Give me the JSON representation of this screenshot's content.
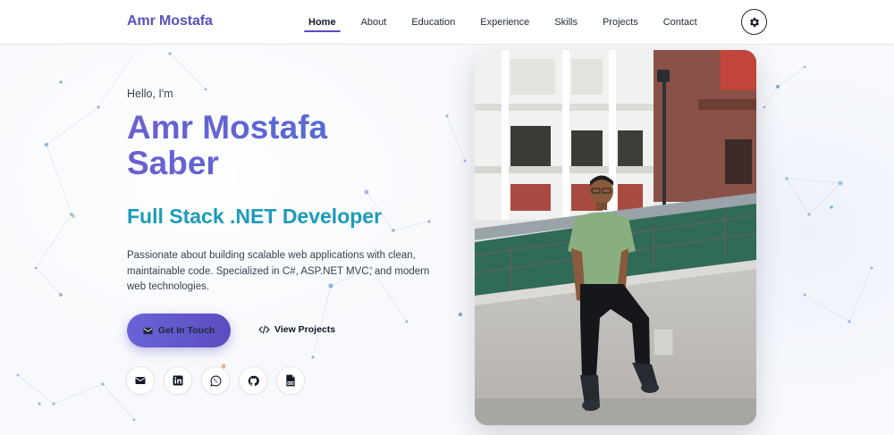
{
  "navbar": {
    "brand": "Amr Mostafa",
    "links": [
      {
        "label": "Home",
        "active": true
      },
      {
        "label": "About"
      },
      {
        "label": "Education"
      },
      {
        "label": "Experience"
      },
      {
        "label": "Skills"
      },
      {
        "label": "Projects"
      },
      {
        "label": "Contact"
      }
    ],
    "theme_toggle_icon": "gear-icon"
  },
  "hero": {
    "greeting": "Hello, I'm",
    "name": "Amr Mostafa Saber",
    "role": "Full Stack .NET Developer",
    "description": "Passionate about building scalable web applications with clean, maintainable code. Specialized in C#, ASP.NET MVC, and modern web technologies.",
    "primary_button": {
      "label": "Get In Touch",
      "icon": "envelope-icon"
    },
    "secondary_button": {
      "label": "View Projects",
      "icon": "code-icon"
    },
    "socials": [
      {
        "icon": "envelope-icon"
      },
      {
        "icon": "linkedin-icon"
      },
      {
        "icon": "whatsapp-icon"
      },
      {
        "icon": "github-icon"
      },
      {
        "icon": "pdf-icon"
      }
    ]
  },
  "colors": {
    "brand": "#5b4fbf",
    "accent": "#1d9bb8",
    "button_gradient_start": "#6a63d8",
    "button_gradient_end": "#5a4dc0"
  }
}
